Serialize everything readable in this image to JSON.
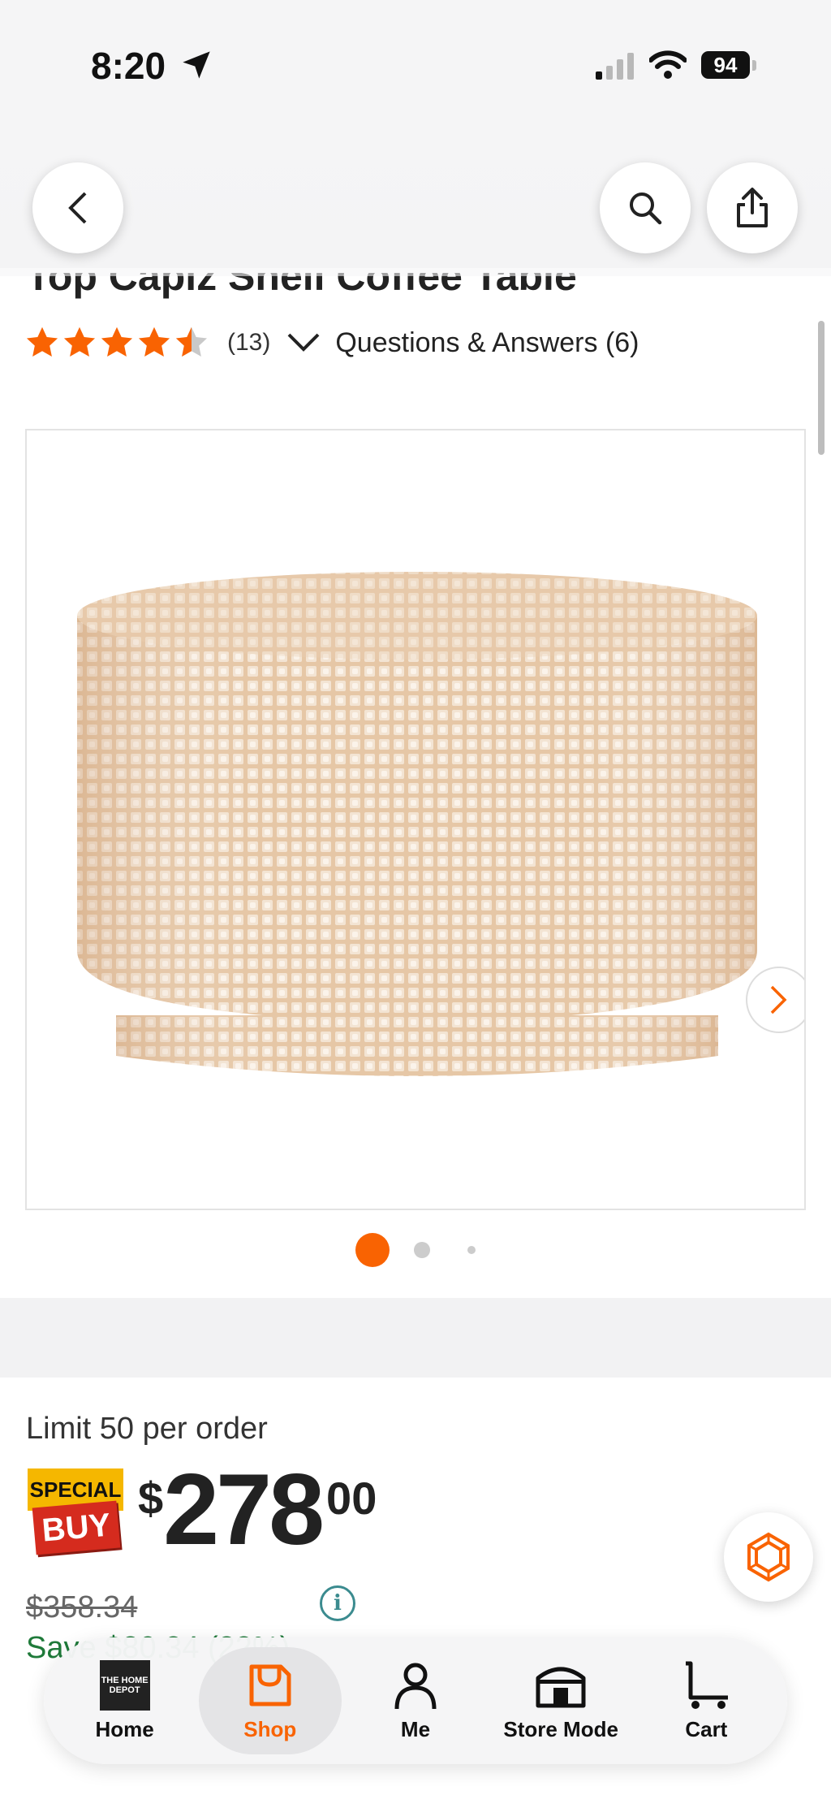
{
  "status_bar": {
    "time": "8:20",
    "battery": "94"
  },
  "header": {
    "back": "back",
    "search": "search",
    "share": "share"
  },
  "product": {
    "title": "Top Capiz Shell Coffee Table",
    "rating_count": "(13)",
    "qa_label": "Questions & Answers (6)",
    "rating_value": 4.5
  },
  "gallery": {
    "image_alt": "Capiz shell round coffee table",
    "current_slide": 1,
    "slides": 3
  },
  "pricing": {
    "limit": "Limit 50 per order",
    "badge_top": "SPECIAL",
    "badge_bottom": "BUY",
    "currency": "$",
    "dollars": "278",
    "cents": "00",
    "was_price": "$358.34",
    "save": "Save $80.34 (22%)",
    "info_icon": "i"
  },
  "nav": {
    "items": [
      {
        "label": "Home",
        "icon": "home-depot-logo-icon"
      },
      {
        "label": "Shop",
        "icon": "shop-bag-icon"
      },
      {
        "label": "Me",
        "icon": "person-icon"
      },
      {
        "label": "Store Mode",
        "icon": "store-icon"
      },
      {
        "label": "Cart",
        "icon": "cart-icon"
      }
    ],
    "logo_text": "THE HOME DEPOT"
  },
  "colors": {
    "accent": "#f96302",
    "save_green": "#1f7a3a"
  }
}
